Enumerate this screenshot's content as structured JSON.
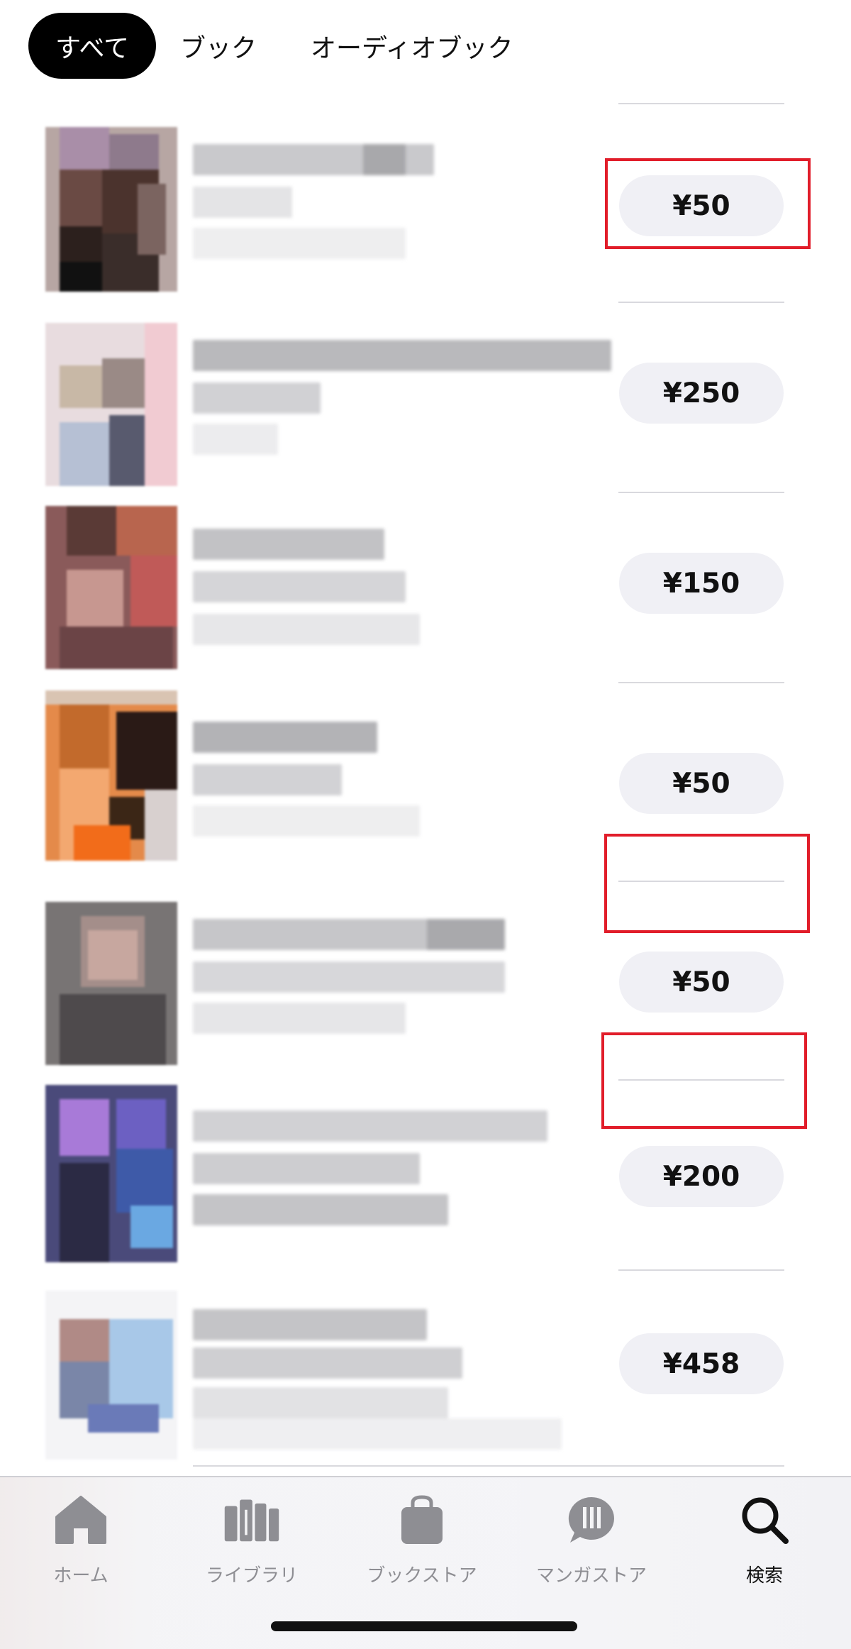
{
  "filter_tabs": [
    {
      "label": "すべて",
      "active": true
    },
    {
      "label": "ブック",
      "active": false
    },
    {
      "label": "オーディオブック",
      "active": false
    }
  ],
  "results": [
    {
      "price": "¥50",
      "highlighted": true
    },
    {
      "price": "¥250",
      "highlighted": false
    },
    {
      "price": "¥150",
      "highlighted": false
    },
    {
      "price": "¥50",
      "highlighted": true
    },
    {
      "price": "¥50",
      "highlighted": true
    },
    {
      "price": "¥200",
      "highlighted": false
    },
    {
      "price": "¥458",
      "highlighted": false
    }
  ],
  "tab_bar": {
    "items": [
      {
        "label": "ホーム",
        "icon": "home-icon",
        "active": false
      },
      {
        "label": "ライブラリ",
        "icon": "library-icon",
        "active": false
      },
      {
        "label": "ブックストア",
        "icon": "bookstore-bag-icon",
        "active": false
      },
      {
        "label": "マンガストア",
        "icon": "manga-bubble-icon",
        "active": false
      },
      {
        "label": "検索",
        "icon": "search-icon",
        "active": true
      }
    ]
  },
  "colors": {
    "highlight_box": "#e11d2a",
    "price_button_bg": "#f0f0f5",
    "active_tab_bg": "#000000",
    "inactive_label": "#8e8e93"
  }
}
